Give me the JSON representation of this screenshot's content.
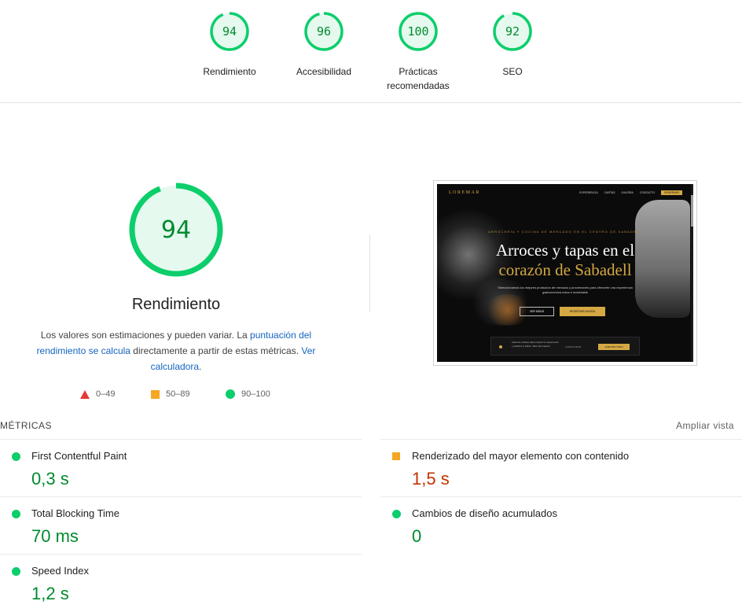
{
  "summary_gauges": [
    {
      "label": "Rendimiento",
      "score": "94"
    },
    {
      "label": "Accesibilidad",
      "score": "96"
    },
    {
      "label": "Prácticas recomendadas",
      "score": "100"
    },
    {
      "label": "SEO",
      "score": "92"
    }
  ],
  "performance": {
    "score": "94",
    "title": "Rendimiento",
    "desc_1": "Los valores son estimaciones y pueden variar. La ",
    "link_1": "puntuación del rendimiento se calcula",
    "desc_2": " directamente a partir de estas métricas. ",
    "link_2": "Ver calculadora",
    "desc_3": "."
  },
  "legend": {
    "fail": "0–49",
    "average": "50–89",
    "pass": "90–100"
  },
  "screenshot": {
    "brand": "LOREMAR",
    "nav": [
      "EXPERIENCIA",
      "CARTAS",
      "GALERÍA",
      "CONTACTO"
    ],
    "nav_cta": "RESERVAR",
    "eyebrow": "ARROCERÍA Y COCINA DE MERCADO EN EL CENTRO DE SABADELL",
    "headline_1": "Arroces y tapas en el",
    "headline_2": "corazón de Sabadell",
    "subtitle": "Seleccionamos los mejores productos de mercado y proveedores para ofrecerte una experiencia gastronómica única e inolvidable",
    "btn_menu": "VER MENÚ",
    "btn_reserve": "RESERVAR AHORA",
    "cookie_text": "Usamos cookies para mejorar tu experiencia y analizar el tráfico. Más información",
    "cookie_config": "CONFIGURAR",
    "cookie_accept": "ACEPTAR TODO"
  },
  "metrics": {
    "heading": "MÉTRICAS",
    "expand": "Ampliar vista",
    "fcp_label": "First Contentful Paint",
    "fcp_value": "0,3 s",
    "lcp_label": "Renderizado del mayor elemento con contenido",
    "lcp_value": "1,5 s",
    "tbt_label": "Total Blocking Time",
    "tbt_value": "70 ms",
    "cls_label": "Cambios de diseño acumulados",
    "cls_value": "0",
    "si_label": "Speed Index",
    "si_value": "1,2 s"
  },
  "colors": {
    "pass": "#0cce6b",
    "pass_text": "#008a2e",
    "average": "#f5a623",
    "average_text": "#c33300",
    "fail": "#e53935",
    "link": "#1565c0"
  }
}
